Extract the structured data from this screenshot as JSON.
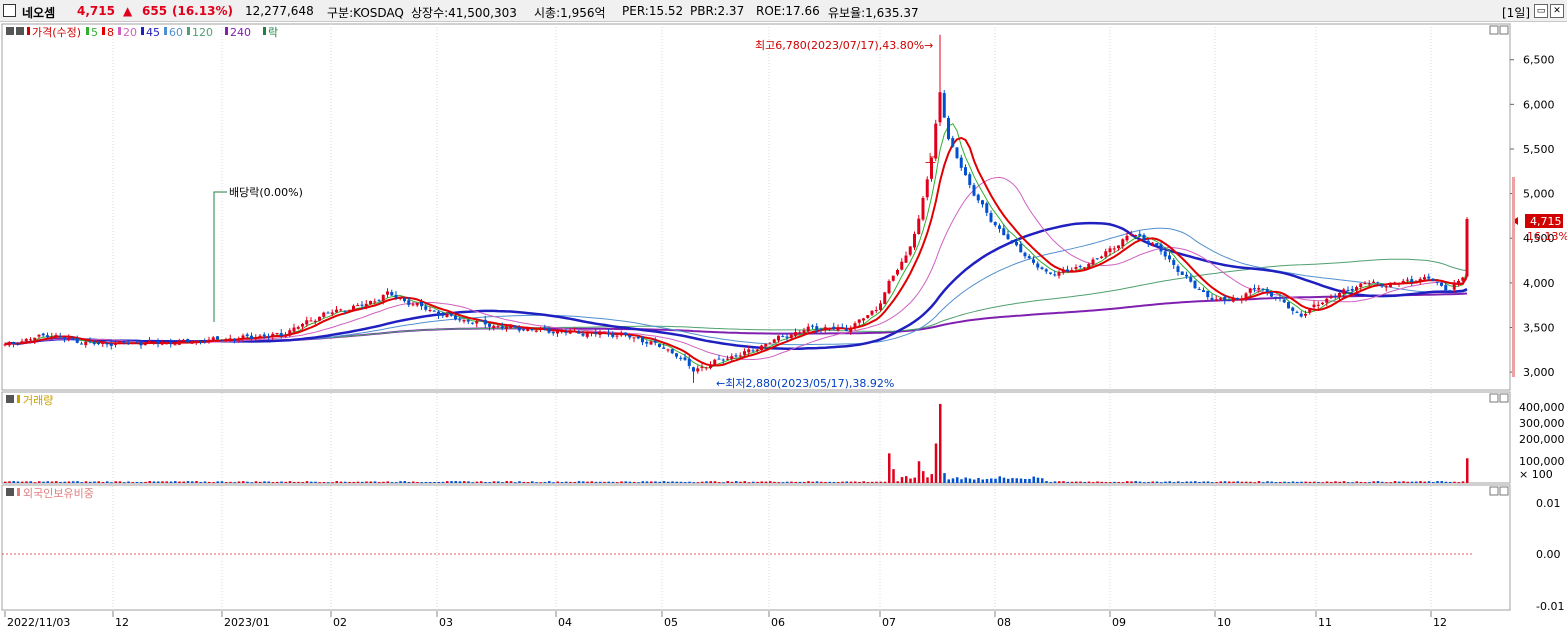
{
  "header": {
    "name": "네오셈",
    "price": "4,715",
    "change_arrow": "▲",
    "change": "655",
    "change_pct": "(16.13%)",
    "volume": "12,277,648",
    "market": "구분:KOSDAQ",
    "shares": "상장수:41,500,303",
    "mcap": "시총:1,956억",
    "per": "PER:15.52",
    "pbr": "PBR:2.37",
    "roe": "ROE:17.66",
    "reserve": "유보율:1,635.37",
    "period": "[1일]",
    "colors": {
      "up": "#e0001b",
      "down": "#0050d0"
    }
  },
  "price_panel": {
    "legend": [
      {
        "label": "가격(수정)",
        "color": "#d00000"
      },
      {
        "label": "5",
        "color": "#30b030"
      },
      {
        "label": "8",
        "color": "#e00000"
      },
      {
        "label": "20",
        "color": "#d060c0"
      },
      {
        "label": "45",
        "color": "#2020c0"
      },
      {
        "label": "60",
        "color": "#5090d0"
      },
      {
        "label": "120",
        "color": "#50a070"
      },
      {
        "label": "240",
        "color": "#8020b0"
      },
      {
        "label": "락",
        "color": "#208040"
      }
    ],
    "annotations": {
      "high": "최고6,780(2023/07/17),43.80%→",
      "low": "←최저2,880(2023/05/17),38.92%",
      "dividend": "배당락(0.00%)",
      "upper_limit": "上"
    },
    "current_price_label": "4,715",
    "current_pct_label": "16.13%"
  },
  "volume_panel": {
    "legend": "거래량",
    "unit": "× 100"
  },
  "foreign_panel": {
    "legend": "외국인보유비중"
  },
  "chart_data": {
    "type": "candlestick",
    "x_ticks": [
      "2022/11/03",
      "12",
      "2023/01",
      "02",
      "03",
      "04",
      "05",
      "06",
      "07",
      "08",
      "09",
      "10",
      "11",
      "12"
    ],
    "price_ticks": [
      "6,500",
      "6,000",
      "5,500",
      "5,000",
      "4,500",
      "4,000",
      "3,500",
      "3,000"
    ],
    "ylim": [
      2800,
      6900
    ],
    "volume_ticks": [
      "400,000",
      "300,000",
      "200,000",
      "100,000"
    ],
    "foreign_ticks": [
      "0.01",
      "0.00",
      "-0.01"
    ],
    "price_keypoints": [
      [
        0,
        3300
      ],
      [
        10,
        3420
      ],
      [
        20,
        3320
      ],
      [
        40,
        3330
      ],
      [
        55,
        3380
      ],
      [
        65,
        3420
      ],
      [
        75,
        3650
      ],
      [
        85,
        3760
      ],
      [
        90,
        3880
      ],
      [
        95,
        3780
      ],
      [
        105,
        3610
      ],
      [
        115,
        3520
      ],
      [
        125,
        3470
      ],
      [
        135,
        3440
      ],
      [
        145,
        3420
      ],
      [
        152,
        3330
      ],
      [
        158,
        3200
      ],
      [
        162,
        3020
      ],
      [
        168,
        3130
      ],
      [
        175,
        3230
      ],
      [
        182,
        3380
      ],
      [
        190,
        3500
      ],
      [
        198,
        3480
      ],
      [
        205,
        3700
      ],
      [
        208,
        4000
      ],
      [
        212,
        4300
      ],
      [
        215,
        4700
      ],
      [
        218,
        5400
      ],
      [
        220,
        6150
      ],
      [
        222,
        5600
      ],
      [
        225,
        5300
      ],
      [
        228,
        5000
      ],
      [
        232,
        4700
      ],
      [
        238,
        4400
      ],
      [
        245,
        4100
      ],
      [
        252,
        4150
      ],
      [
        258,
        4300
      ],
      [
        265,
        4550
      ],
      [
        270,
        4450
      ],
      [
        275,
        4200
      ],
      [
        280,
        3950
      ],
      [
        285,
        3800
      ],
      [
        290,
        3820
      ],
      [
        295,
        3960
      ],
      [
        300,
        3800
      ],
      [
        305,
        3630
      ],
      [
        310,
        3800
      ],
      [
        315,
        3900
      ],
      [
        320,
        4000
      ],
      [
        325,
        3980
      ],
      [
        330,
        4020
      ],
      [
        335,
        4050
      ],
      [
        340,
        3920
      ],
      [
        343,
        4060
      ],
      [
        344,
        4715
      ]
    ],
    "high": {
      "date": "2023/07/17",
      "value": 6780
    },
    "low": {
      "date": "2023/05/17",
      "value": 2880
    },
    "last": {
      "close": 4715,
      "change": 655,
      "change_pct": 16.13
    }
  }
}
